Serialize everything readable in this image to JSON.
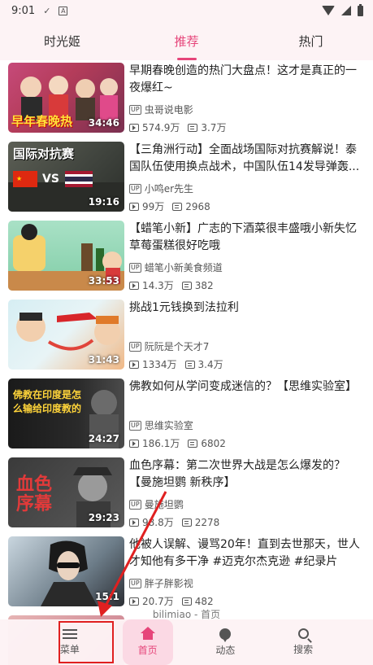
{
  "status_bar": {
    "time": "9:01",
    "download_glyph": "✓",
    "a_glyph": "A"
  },
  "tabs": [
    {
      "label": "时光姬",
      "active": false
    },
    {
      "label": "推荐",
      "active": true
    },
    {
      "label": "热门",
      "active": false
    }
  ],
  "videos": [
    {
      "title": "早期春晚创造的热门大盘点！这才是真正的一夜爆红~",
      "uploader": "虫哥说电影",
      "views": "574.9万",
      "danmaku": "3.7万",
      "duration": "34:46",
      "thumb_text": "早年春晚热"
    },
    {
      "title": "【三角洲行动】全面战场国际对抗赛解说！泰国队伍使用换点战术，中国队伍14发导弹轰...",
      "uploader": "小鸣er先生",
      "views": "99万",
      "danmaku": "2968",
      "duration": "19:16",
      "thumb_text": "国际对抗赛"
    },
    {
      "title": "【蜡笔小新】广志的下酒菜很丰盛哦小新失忆草莓蛋糕很好吃哦",
      "uploader": "蜡笔小新美食频道",
      "views": "14.3万",
      "danmaku": "382",
      "duration": "33:53",
      "thumb_text": ""
    },
    {
      "title": "挑战1元钱换到法拉利",
      "uploader": "阮阮是个天才7",
      "views": "1334万",
      "danmaku": "3.4万",
      "duration": "31:43",
      "thumb_text": ""
    },
    {
      "title": "佛教如何从学问变成迷信的？【思维实验室】",
      "uploader": "思维实验室",
      "views": "186.1万",
      "danmaku": "6802",
      "duration": "24:27",
      "thumb_text": "佛教在印度是怎么输给印度教的"
    },
    {
      "title": "血色序幕：第二次世界大战是怎么爆发的？【曼施坦鹦 新秩序】",
      "uploader": "曼施坦鹦",
      "views": "98.8万",
      "danmaku": "2278",
      "duration": "29:23",
      "thumb_text": "血色序幕"
    },
    {
      "title": "他被人误解、谩骂20年！直到去世那天，世人才知他有多干净 #迈克尔杰克逊 #纪录片",
      "uploader": "胖子胖影视",
      "views": "20.7万",
      "danmaku": "482",
      "duration": "15:1",
      "thumb_text": ""
    },
    {
      "title": "",
      "uploader": "",
      "views": "",
      "danmaku": "",
      "duration": "",
      "thumb_text": ""
    }
  ],
  "bottom_caption": "bilimiao - 首页",
  "nav": [
    {
      "label": "菜单",
      "icon": "menu-icon",
      "active": false
    },
    {
      "label": "首页",
      "icon": "home-icon",
      "active": true
    },
    {
      "label": "动态",
      "icon": "dynamic-icon",
      "active": false
    },
    {
      "label": "搜索",
      "icon": "search-icon",
      "active": false
    }
  ],
  "colors": {
    "accent": "#e6457a",
    "annotation": "#e02020",
    "header_bg": "#fdf3f5"
  }
}
